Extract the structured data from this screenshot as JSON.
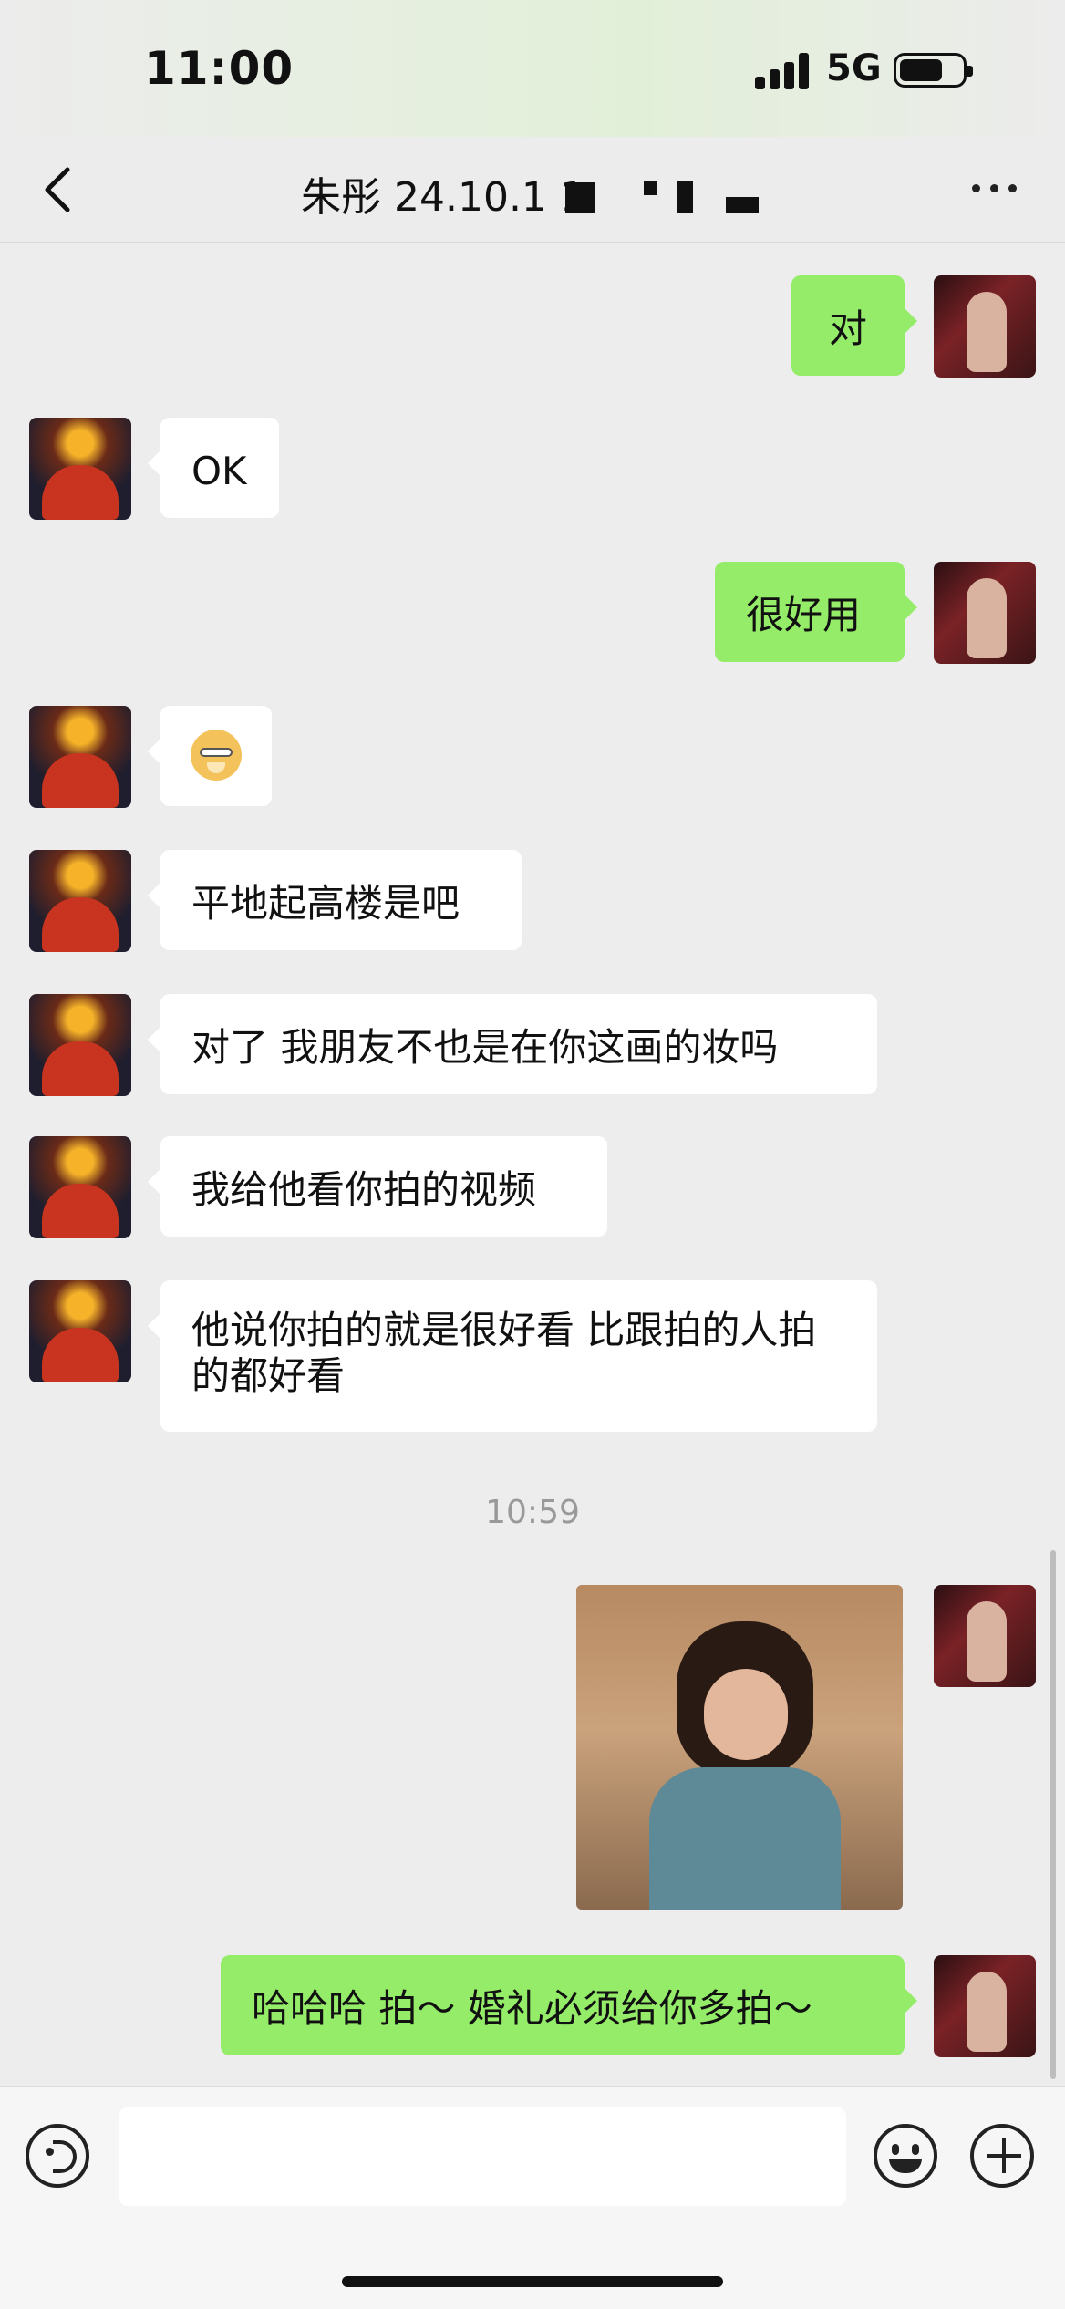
{
  "status_bar": {
    "time": "11:00",
    "network": "5G"
  },
  "header": {
    "title": "朱彤 24.10.1 1"
  },
  "messages": [
    {
      "from": "me",
      "text": "对"
    },
    {
      "from": "other",
      "text": "OK"
    },
    {
      "from": "me",
      "text": "很好用"
    },
    {
      "from": "other",
      "sticker": "doge-emoji-sticker"
    },
    {
      "from": "other",
      "text": "平地起高楼是吧"
    },
    {
      "from": "other",
      "text": "对了 我朋友不也是在你这画的妆吗"
    },
    {
      "from": "other",
      "text": "我给他看你拍的视频"
    },
    {
      "from": "other",
      "text": "他说你拍的就是很好看 比跟拍的人拍的都好看"
    },
    {
      "from": "me",
      "image": "girl-photo-sticker"
    },
    {
      "from": "me",
      "text": "哈哈哈 拍～ 婚礼必须给你多拍～"
    }
  ],
  "timestamp": "10:59",
  "input_bar": {
    "placeholder": ""
  },
  "colors": {
    "my_bubble": "#95ec69",
    "their_bubble": "#ffffff",
    "background": "#ededed"
  }
}
